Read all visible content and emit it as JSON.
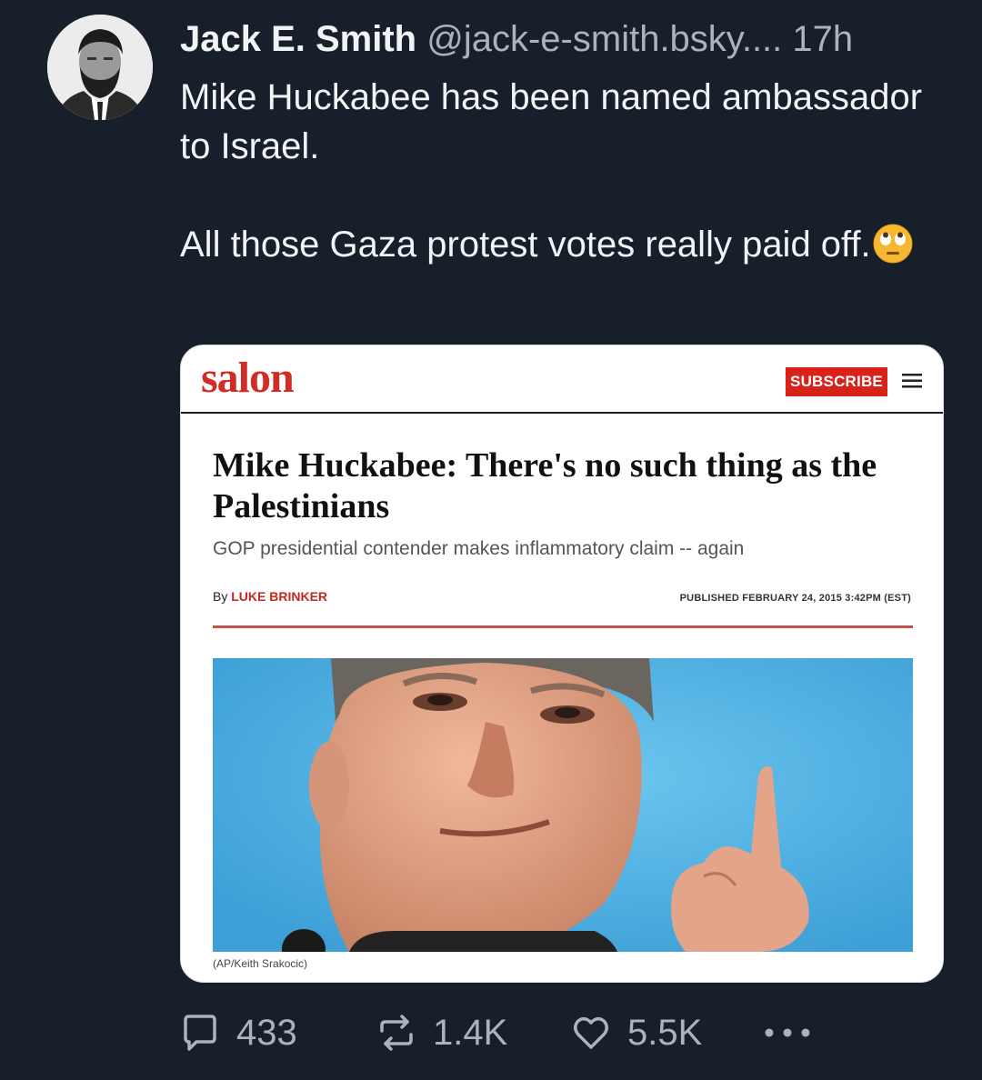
{
  "author": {
    "display_name": "Jack E. Smith",
    "handle": "@jack-e-smith.bsky....",
    "timestamp": "17h",
    "avatar_icon": "avatar-portrait"
  },
  "post": {
    "line1": "Mike Huckabee has been named ambassador to Israel.",
    "line2": "All those Gaza protest votes really paid off.",
    "emoji_icon": "eye-roll-emoji-icon"
  },
  "embed": {
    "site_logo": "salon",
    "subscribe_label": "SUBSCRIBE",
    "menu_icon": "hamburger-menu-icon",
    "headline": "Mike Huckabee: There's no such thing as the Palestinians",
    "dek": "GOP presidential contender makes inflammatory claim -- again",
    "byline_prefix": "By ",
    "byline_author": "LUKE BRINKER",
    "published": "PUBLISHED FEBRUARY 24, 2015 3:42PM (EST)",
    "photo_credit": "(AP/Keith Srakocic)",
    "colors": {
      "brand_red": "#d02d24",
      "photo_background": "#4fb0e0"
    }
  },
  "actions": {
    "replies": "433",
    "reposts": "1.4K",
    "likes": "5.5K",
    "more_icon": "more-options-icon"
  },
  "theme": {
    "background": "#171f2a",
    "text": "#f1f3f5",
    "muted": "#a9b3c0"
  }
}
